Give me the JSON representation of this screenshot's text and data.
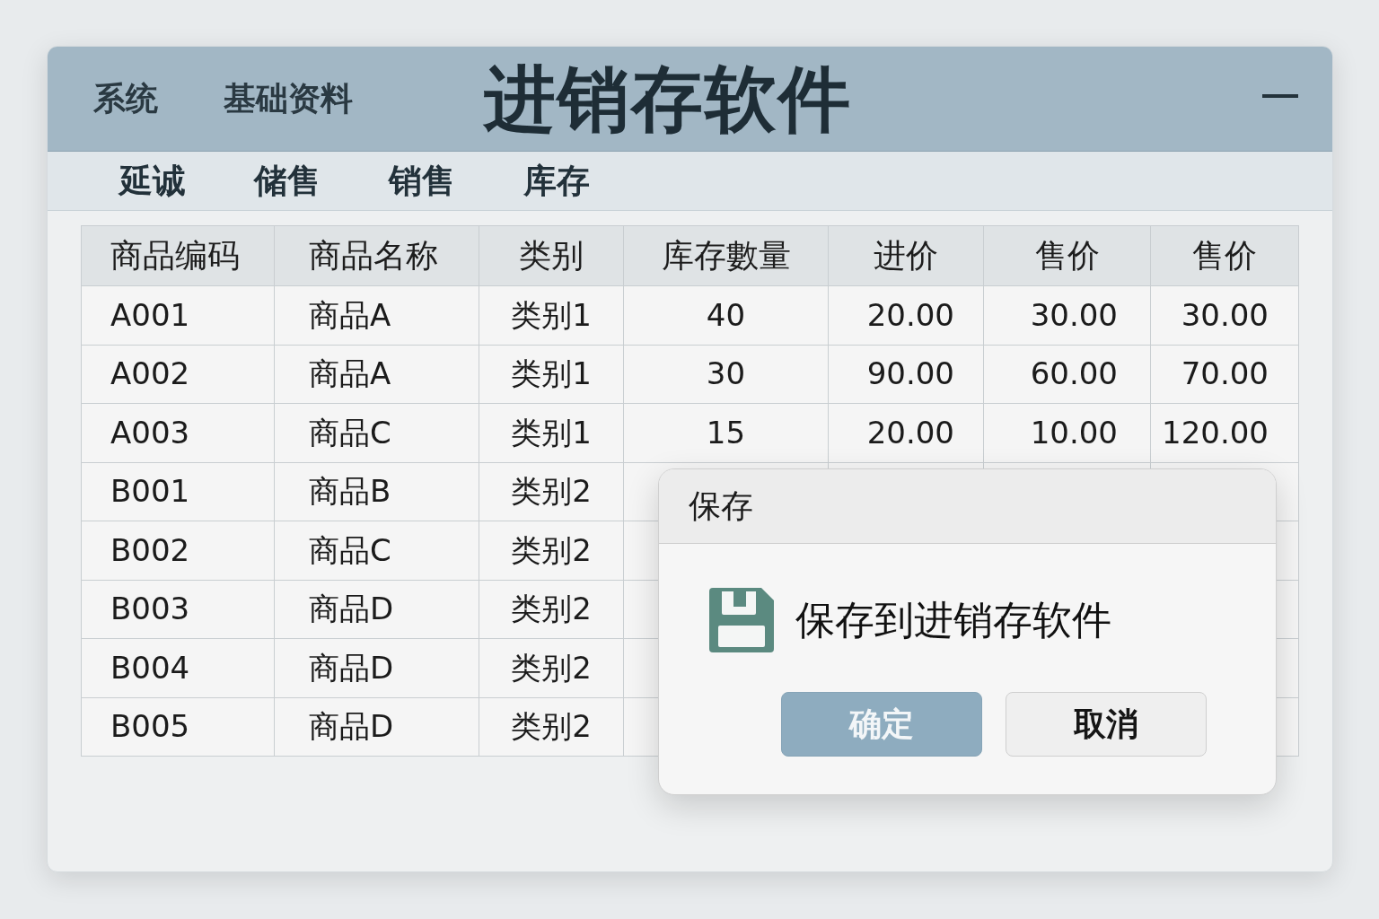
{
  "window": {
    "title": "进销存软件"
  },
  "menu_bar": {
    "items": [
      "系统",
      "基础资料"
    ]
  },
  "toolbar": {
    "items": [
      "延诚",
      "储售",
      "销售",
      "库存"
    ]
  },
  "table": {
    "columns": [
      "商品编码",
      "商品名称",
      "类别",
      "库存數量",
      "进价",
      "售价",
      "售价"
    ],
    "rows": [
      [
        "A001",
        "商品A",
        "类别1",
        "40",
        "20.00",
        "30.00",
        "30.00"
      ],
      [
        "A002",
        "商品A",
        "类别1",
        "30",
        "90.00",
        "60.00",
        "70.00"
      ],
      [
        "A003",
        "商品C",
        "类别1",
        "15",
        "20.00",
        "10.00",
        "120.00"
      ],
      [
        "B001",
        "商品B",
        "类别2"
      ],
      [
        "B002",
        "商品C",
        "类别2"
      ],
      [
        "B003",
        "商品D",
        "类别2"
      ],
      [
        "B004",
        "商品D",
        "类别2"
      ],
      [
        "B005",
        "商品D",
        "类别2"
      ]
    ]
  },
  "dialog": {
    "title": "保存",
    "message": "保存到进销存软件",
    "buttons": [
      {
        "label": "确定",
        "kind": "primary"
      },
      {
        "label": "取消",
        "kind": "secondary"
      }
    ]
  }
}
